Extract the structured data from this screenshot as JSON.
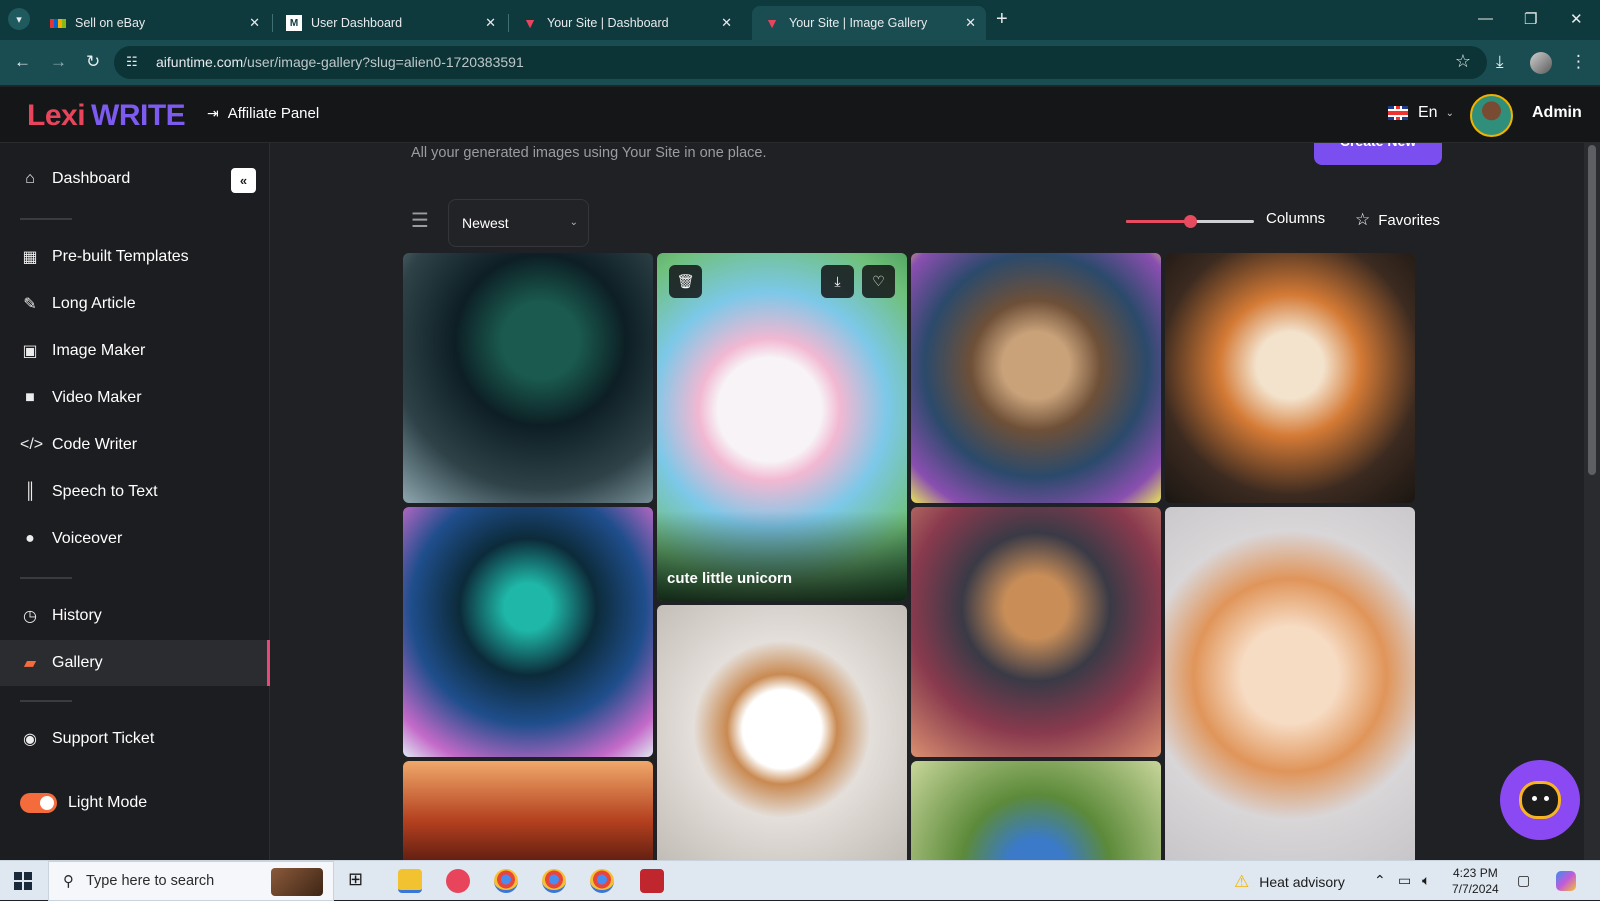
{
  "browser": {
    "tabs": [
      {
        "title": "Sell on eBay",
        "active": false
      },
      {
        "title": "User Dashboard",
        "active": false
      },
      {
        "title": "Your Site | Dashboard",
        "active": false
      },
      {
        "title": "Your Site | Image Gallery",
        "active": true
      }
    ],
    "url_host": "aifuntime.com",
    "url_path": "/user/image-gallery?slug=alien0-1720383591"
  },
  "app": {
    "logo_part1": "Lexi",
    "logo_part2": "WRITE",
    "affiliate_label": "Affiliate Panel",
    "language": "En",
    "user_name": "Admin"
  },
  "sidebar": {
    "items": [
      {
        "label": "Dashboard",
        "icon": "home-icon"
      },
      {
        "label": "Pre-built Templates",
        "icon": "grid-icon"
      },
      {
        "label": "Long Article",
        "icon": "pen-icon"
      },
      {
        "label": "Image Maker",
        "icon": "image-icon"
      },
      {
        "label": "Video Maker",
        "icon": "video-icon"
      },
      {
        "label": "Code Writer",
        "icon": "code-icon"
      },
      {
        "label": "Speech to Text",
        "icon": "waveform-icon"
      },
      {
        "label": "Voiceover",
        "icon": "mic-icon"
      },
      {
        "label": "History",
        "icon": "history-icon"
      },
      {
        "label": "Gallery",
        "icon": "gallery-icon",
        "active": true
      },
      {
        "label": "Support Ticket",
        "icon": "support-icon"
      },
      {
        "label": "Light Mode",
        "icon": "toggle-icon"
      }
    ]
  },
  "gallery": {
    "subtitle": "All your generated images using Your Site in one place.",
    "create_label": "Create New",
    "sort_value": "Newest",
    "columns_label": "Columns",
    "columns_level": 0.5,
    "favorites_label": "Favorites",
    "hover_caption": "cute little unicorn"
  },
  "taskbar": {
    "search_placeholder": "Type here to search",
    "weather": "Heat advisory",
    "time": "4:23 PM",
    "date": "7/7/2024"
  },
  "colors": {
    "brand_red": "#e8455c",
    "brand_purple": "#7d5bf0",
    "accent": "#e84a5f",
    "create_button": "#7b4ef0"
  }
}
